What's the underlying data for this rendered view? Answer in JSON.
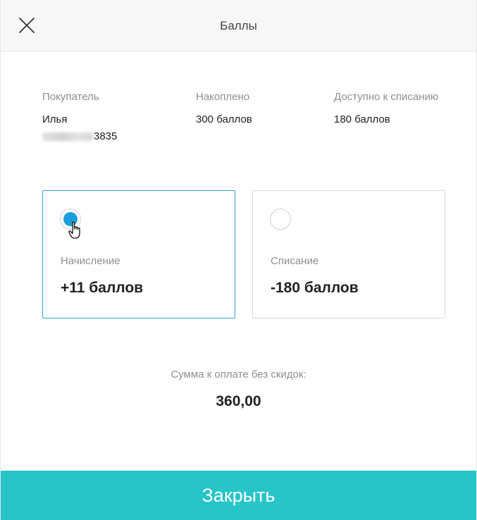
{
  "header": {
    "title": "Баллы",
    "close_icon": "close-icon"
  },
  "buyer": {
    "label": "Покупатель",
    "name": "Илья",
    "phone_suffix": "3835"
  },
  "accumulated": {
    "label": "Накоплено",
    "value": "300 баллов"
  },
  "available": {
    "label": "Доступно к списанию",
    "value": "180 баллов"
  },
  "options": [
    {
      "label": "Начисление",
      "value": "+11 баллов",
      "selected": true
    },
    {
      "label": "Списание",
      "value": "-180 баллов",
      "selected": false
    }
  ],
  "summary": {
    "label": "Сумма к оплате без скидок:",
    "value": "360,00"
  },
  "footer": {
    "close_label": "Закрыть"
  },
  "colors": {
    "accent": "#27c4c8",
    "radio_selected": "#1e9ddc",
    "card_selected_border": "#3a9ed5"
  }
}
